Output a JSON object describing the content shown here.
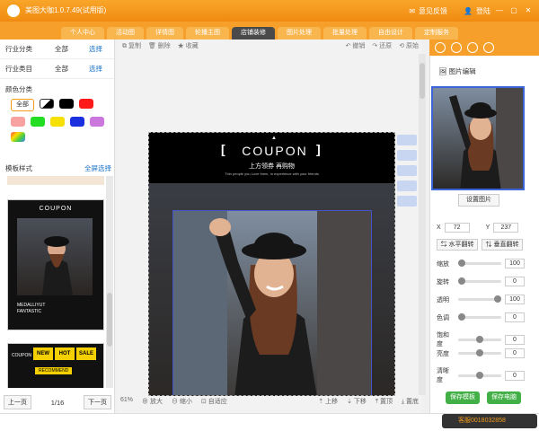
{
  "app": {
    "title": "美图大咖1.0.7.49(试用版)"
  },
  "titlebar": {
    "feedback": "意见反馈",
    "login": "登陆"
  },
  "tabs": [
    {
      "label": "个人中心"
    },
    {
      "label": "活动图"
    },
    {
      "label": "详情图"
    },
    {
      "label": "轮播主图"
    },
    {
      "label": "店铺装修"
    },
    {
      "label": "图片处理"
    },
    {
      "label": "批量处理"
    },
    {
      "label": "自由设计"
    },
    {
      "label": "定制服务"
    }
  ],
  "left": {
    "industry_category": {
      "label": "行业分类",
      "value": "全部",
      "link": "选择"
    },
    "industry_sub": {
      "label": "行业类目",
      "value": "全部",
      "link": "选择"
    },
    "color_category": "颜色分类",
    "all_label": "全部",
    "colors": [
      "#111111",
      "#000000",
      "#ff0000",
      "#f7a1a1",
      "#22dd22",
      "#f5e000",
      "#1a2fdd",
      "#cc77dd",
      "#ff9933"
    ],
    "template_style": "模板样式",
    "fullscreen": "全屏选择",
    "pager": {
      "prev": "上一页",
      "page": "1/16",
      "next": "下一页"
    },
    "thumb1": {
      "title": "COUPON",
      "lines": [
        "MEDALLIYUT",
        "FANTASTIC"
      ]
    },
    "thumb2": {
      "new": "NEW",
      "hot": "HOT",
      "sale": "SALE",
      "coupon": "COUPON",
      "recommend": "RECOMMEND"
    }
  },
  "toolbar": {
    "copy": "复制",
    "delete": "删除",
    "favorite": "收藏",
    "undo": "撤销",
    "redo": "还原",
    "original": "原始"
  },
  "canvas": {
    "coupon": "COUPON",
    "subtitle": "上方领券 再购物",
    "tagline": "Thin people you Love them, In experience with your friends"
  },
  "bottom": {
    "zoom": "61%",
    "zoom_in": "放大",
    "zoom_out": "缩小",
    "fit": "自适应",
    "up": "上移",
    "down": "下移",
    "top": "置顶",
    "bottom": "置底"
  },
  "right": {
    "section": "图片编辑",
    "set_image": "设置图片",
    "x_label": "X",
    "x_value": "72",
    "y_label": "Y",
    "y_value": "237",
    "hflip": "水平翻转",
    "vflip": "垂直翻转",
    "scale": {
      "label": "缩放",
      "value": "100"
    },
    "rotate": {
      "label": "旋转",
      "value": "0"
    },
    "opacity": {
      "label": "透明",
      "value": "100"
    },
    "hue": {
      "label": "色调",
      "value": "0"
    },
    "saturation": {
      "label": "饱和度",
      "value": "0"
    },
    "brightness": {
      "label": "亮度",
      "value": "0"
    },
    "contrast": {
      "label": "清晰度",
      "value": "0"
    },
    "save_template": "保存模板",
    "save_pc": "保存电脑"
  },
  "status": {
    "hotline": "客服0018032858"
  }
}
